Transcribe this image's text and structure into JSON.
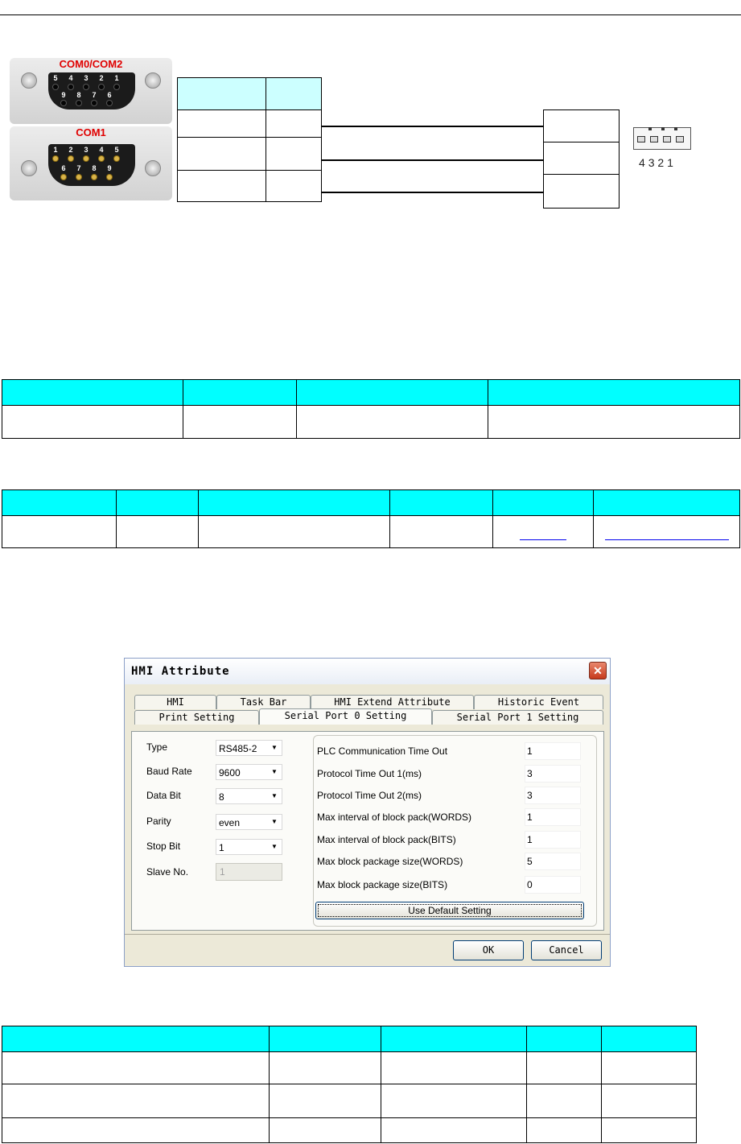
{
  "connectors": {
    "top": {
      "title": "COM0/COM2",
      "row1_pins": [
        "5",
        "4",
        "3",
        "2",
        "1"
      ],
      "row2_pins": [
        "9",
        "8",
        "7",
        "6"
      ]
    },
    "bottom": {
      "title": "COM1",
      "row1_pins": [
        "1",
        "2",
        "3",
        "4",
        "5"
      ],
      "row2_pins": [
        "6",
        "7",
        "8",
        "9"
      ]
    }
  },
  "terminal_labels": [
    "4",
    "3",
    "2",
    "1"
  ],
  "table1": {
    "rows": [
      [
        "",
        "",
        "",
        ""
      ],
      [
        "",
        "",
        "",
        ""
      ]
    ]
  },
  "table2": {
    "rows": [
      [
        "",
        "",
        "",
        "",
        "",
        ""
      ],
      [
        "",
        "",
        "",
        "",
        "",
        ""
      ]
    ]
  },
  "dialog": {
    "title": "HMI Attribute",
    "close_icon": "close-x-icon",
    "tabs_row1": [
      "HMI",
      "Task Bar",
      "HMI Extend Attribute",
      "Historic Event"
    ],
    "tabs_row2": [
      "Print Setting",
      "Serial Port 0 Setting",
      "Serial Port 1 Setting"
    ],
    "active_tab": "Serial Port 0 Setting",
    "left_fields": {
      "type": {
        "label": "Type",
        "value": "RS485-2"
      },
      "baud_rate": {
        "label": "Baud Rate",
        "value": "9600"
      },
      "data_bit": {
        "label": "Data Bit",
        "value": "8"
      },
      "parity": {
        "label": "Parity",
        "value": "even"
      },
      "stop_bit": {
        "label": "Stop Bit",
        "value": "1"
      },
      "slave_no": {
        "label": "Slave No.",
        "value": "1"
      }
    },
    "right_fields": [
      {
        "label": "PLC Communication Time Out",
        "value": "1"
      },
      {
        "label": "Protocol Time Out 1(ms)",
        "value": "3"
      },
      {
        "label": "Protocol Time Out 2(ms)",
        "value": "3"
      },
      {
        "label": "Max interval of block pack(WORDS)",
        "value": "1"
      },
      {
        "label": "Max interval of block pack(BITS)",
        "value": "1"
      },
      {
        "label": "Max block package size(WORDS)",
        "value": "5"
      },
      {
        "label": "Max block package size(BITS)",
        "value": "0"
      }
    ],
    "default_button": "Use Default Setting",
    "ok_button": "OK",
    "cancel_button": "Cancel"
  },
  "table3": {
    "rows": [
      [
        "",
        "",
        "",
        "",
        ""
      ],
      [
        "",
        "",
        "",
        "",
        ""
      ],
      [
        "",
        "",
        "",
        "",
        ""
      ],
      [
        "",
        "",
        "",
        "",
        ""
      ]
    ]
  }
}
